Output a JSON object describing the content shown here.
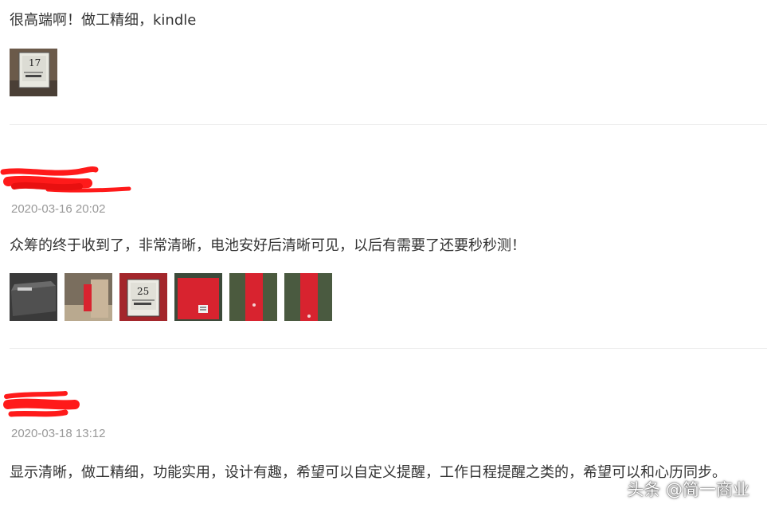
{
  "reviews": [
    {
      "text": "很高端啊！做工精细，kindle",
      "photo_count": 1
    },
    {
      "date": "2020-03-16 20:02",
      "text": "众筹的终于收到了，非常清晰，电池安好后清晰可见，以后有需要了还要秒秒测！",
      "photo_count": 6
    },
    {
      "date": "2020-03-18 13:12",
      "text": "显示清晰，做工精细，功能实用，设计有趣，希望可以自定义提醒，工作日程提醒之类的，希望可以和心历同步。"
    }
  ],
  "photo_numbers": {
    "first": "17",
    "third": "25"
  },
  "watermark": "头条 @简一商业",
  "colors": {
    "redaction": "#ff1a1a",
    "date": "#999999",
    "divider": "#ececec",
    "product_red": "#d8232f"
  }
}
